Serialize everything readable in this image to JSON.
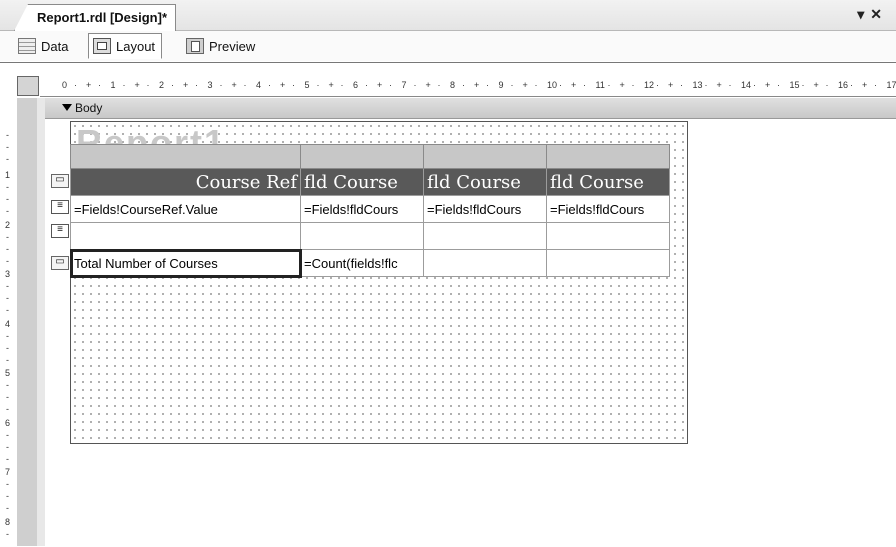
{
  "document_tab": {
    "title": "Report1.rdl [Design]*"
  },
  "window_controls": {
    "dropdown": "▾",
    "close": "✕"
  },
  "view_tabs": [
    {
      "label": "Data",
      "icon": "data-icon"
    },
    {
      "label": "Layout",
      "icon": "layout-icon",
      "active": true
    },
    {
      "label": "Preview",
      "icon": "preview-icon"
    }
  ],
  "ruler": {
    "horizontal": [
      "0",
      "1",
      "2",
      "3",
      "4",
      "5",
      "6",
      "7",
      "8",
      "9",
      "10",
      "11",
      "12",
      "13",
      "14",
      "15",
      "16",
      "17"
    ],
    "vertical": [
      "1",
      "2",
      "3",
      "4",
      "5",
      "6",
      "7",
      "8"
    ]
  },
  "body_section": {
    "label": "Body"
  },
  "ghost_title": "Report1",
  "table": {
    "header": [
      "Course Ref",
      "fld Course",
      "fld Course",
      "fld Course"
    ],
    "detail": [
      "=Fields!CourseRef.Value",
      "=Fields!fldCours",
      "=Fields!fldCours",
      "=Fields!fldCours"
    ],
    "blank": [
      "",
      "",
      "",
      ""
    ],
    "footer": [
      "Total Number of Courses",
      "=Count(fields!flc",
      "",
      ""
    ]
  }
}
